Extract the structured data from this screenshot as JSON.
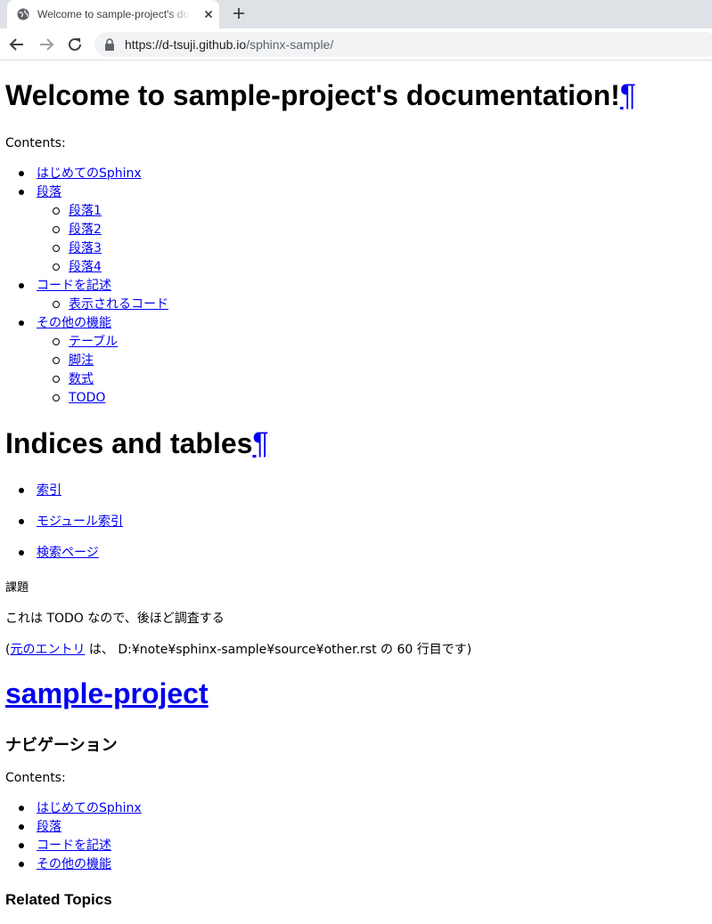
{
  "browser": {
    "tab_title": "Welcome to sample-project's documentation!",
    "url_host": "https://d-tsuji.github.io",
    "url_path": "/sphinx-sample/"
  },
  "doc": {
    "title": "Welcome to sample-project's documentation!",
    "pilcrow": "¶",
    "contents_caption": "Contents:",
    "toc": [
      {
        "label": "はじめてのSphinx",
        "children": []
      },
      {
        "label": "段落",
        "children": [
          "段落1",
          "段落2",
          "段落3",
          "段落4"
        ]
      },
      {
        "label": "コードを記述",
        "children": [
          "表示されるコード"
        ]
      },
      {
        "label": "その他の機能",
        "children": [
          "テーブル",
          "脚注",
          "数式",
          "TODO"
        ]
      }
    ],
    "indices_title": "Indices and tables",
    "indices": [
      "索引",
      "モジュール索引",
      "検索ページ"
    ],
    "todo_heading": "課題",
    "todo_text": "これは TODO なので、後ほど調査する",
    "origin_open": "(",
    "origin_link": "元のエントリ",
    "origin_rest": " は、 D:¥note¥sphinx-sample¥source¥other.rst の 60 行目です)"
  },
  "sidebar": {
    "project_name": "sample-project",
    "nav_heading": "ナビゲーション",
    "contents_caption": "Contents:",
    "toc": [
      "はじめてのSphinx",
      "段落",
      "コードを記述",
      "その他の機能"
    ],
    "related_heading": "Related Topics"
  }
}
